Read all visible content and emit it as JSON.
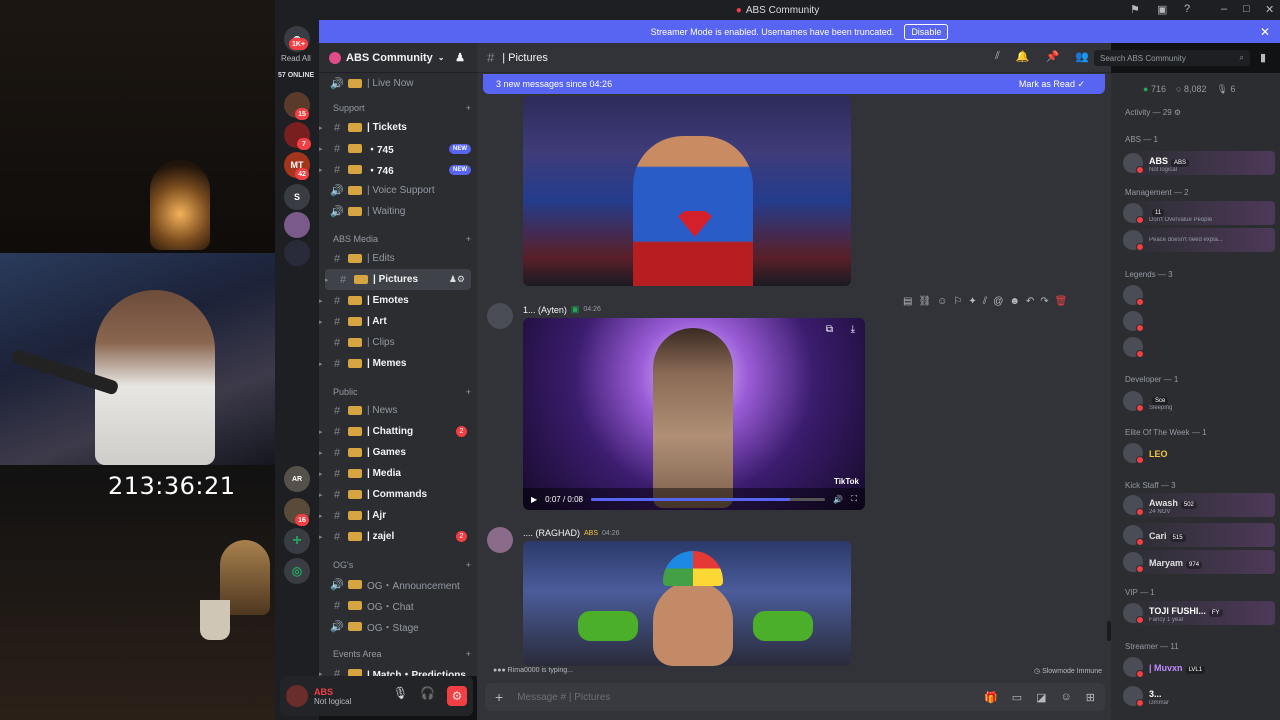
{
  "stream": {
    "timer": "213:36:21"
  },
  "window": {
    "title": "ABS Community"
  },
  "banner": {
    "text": "Streamer Mode is enabled. Usernames have been truncated.",
    "button": "Disable"
  },
  "rail": {
    "top_label": "Read All",
    "top_badge": "1K+",
    "online": "57 ONLINE",
    "servers": [
      {
        "badge": "15"
      },
      {
        "badge": "7"
      },
      {
        "label": "MT",
        "badge": "42"
      },
      {
        "label": "S"
      },
      {
        "badge": ""
      },
      {
        "badge": ""
      },
      {
        "label": "AR"
      },
      {
        "badge": "16"
      }
    ]
  },
  "sidebar": {
    "server_name": "ABS Community",
    "channels": [
      {
        "label": "| Live Now",
        "type": "voice"
      },
      {
        "category": "Support"
      },
      {
        "label": "| Tickets",
        "bright": true
      },
      {
        "label": "・745",
        "bright": true,
        "badge": "NEW"
      },
      {
        "label": "・746",
        "bright": true,
        "badge": "NEW"
      },
      {
        "label": "| Voice Support",
        "type": "voice"
      },
      {
        "label": "| Waiting",
        "type": "voice"
      },
      {
        "category": "ABS Media"
      },
      {
        "label": "| Edits"
      },
      {
        "label": "| Pictures",
        "active": true
      },
      {
        "label": "| Emotes",
        "bright": true
      },
      {
        "label": "| Art",
        "bright": true
      },
      {
        "label": "| Clips"
      },
      {
        "label": "| Memes",
        "bright": true
      },
      {
        "category": "Public"
      },
      {
        "label": "| News"
      },
      {
        "label": "| Chatting",
        "bright": true,
        "count": "2"
      },
      {
        "label": "| Games",
        "bright": true
      },
      {
        "label": "| Media",
        "bright": true
      },
      {
        "label": "| Commands",
        "bright": true
      },
      {
        "label": "| Ajr",
        "bright": true
      },
      {
        "label": "| zajel",
        "bright": true,
        "count": "2"
      },
      {
        "category": "OG's"
      },
      {
        "label": "OG・Announcement",
        "type": "voice"
      },
      {
        "label": "OG・Chat"
      },
      {
        "label": "OG・Stage",
        "type": "voice"
      },
      {
        "category": "Events Area"
      },
      {
        "label": "| Match・Predictions",
        "bright": true
      }
    ]
  },
  "user": {
    "name": "ABS",
    "status": "Not logical"
  },
  "chat": {
    "channel": "| Pictures",
    "new_messages": "3 new messages since 04:26",
    "mark_read": "Mark as Read",
    "search_placeholder": "Search ABS Community",
    "msg1": {
      "author": "1... (Ayten)",
      "time": "04:26",
      "video_time": "0:07 / 0:08",
      "video_progress": 0.85,
      "watermark": "TikTok"
    },
    "msg2": {
      "author": ".... (RAGHAD)",
      "tag": "ABS",
      "time": "04:26"
    },
    "typing": "Rima0000 is typing...",
    "slowmode": "Slowmode Immune",
    "composer_placeholder": "Message # | Pictures"
  },
  "members": {
    "online": "716",
    "total": "8,082",
    "voice": "6",
    "activity": "Activity — 29",
    "groups": [
      {
        "role": "ABS — 1",
        "members": [
          {
            "name": "ABS",
            "tag": "ABS",
            "status": "Not logical",
            "color": "#ffffff"
          }
        ]
      },
      {
        "role": "Management — 2",
        "members": [
          {
            "name": "",
            "tag": "11",
            "status": "Don't Overvalue People",
            "color": "#c08bff"
          },
          {
            "name": "",
            "tag": "",
            "status": "Peace doesn't need expla...",
            "color": "#c08bff"
          }
        ]
      },
      {
        "role": "Legends — 3",
        "members": [
          {
            "name": "",
            "color": "#f23f43"
          },
          {
            "name": "",
            "color": "#f23f43"
          },
          {
            "name": "",
            "color": "#f23f43"
          }
        ]
      },
      {
        "role": "Developer — 1",
        "members": [
          {
            "name": "",
            "tag": "Sce",
            "status": "Sleeping",
            "color": "#5865f2"
          }
        ]
      },
      {
        "role": "Elite Of The Week — 1",
        "members": [
          {
            "name": "LEO",
            "status": "",
            "color": "#f0c541"
          }
        ]
      },
      {
        "role": "Kick Staff — 3",
        "members": [
          {
            "name": "Awash",
            "tag": "502",
            "status": "24 NOV",
            "color": "#e0e0e0"
          },
          {
            "name": "Cari",
            "tag": "515",
            "color": "#e0e0e0"
          },
          {
            "name": "Maryam",
            "tag": "974",
            "color": "#e0e0e0"
          }
        ]
      },
      {
        "role": "VIP — 1",
        "members": [
          {
            "name": "TOJI FUSHI...",
            "tag": "FY",
            "status": "Fancy 1 year",
            "color": "#ffffff"
          }
        ]
      },
      {
        "role": "Streamer — 11",
        "members": [
          {
            "name": "| Muvxn",
            "tag": "LVL1",
            "status": "",
            "color": "#c08bff"
          },
          {
            "name": "3...",
            "status": "i3mmar",
            "color": "#ffffff"
          }
        ]
      }
    ]
  }
}
